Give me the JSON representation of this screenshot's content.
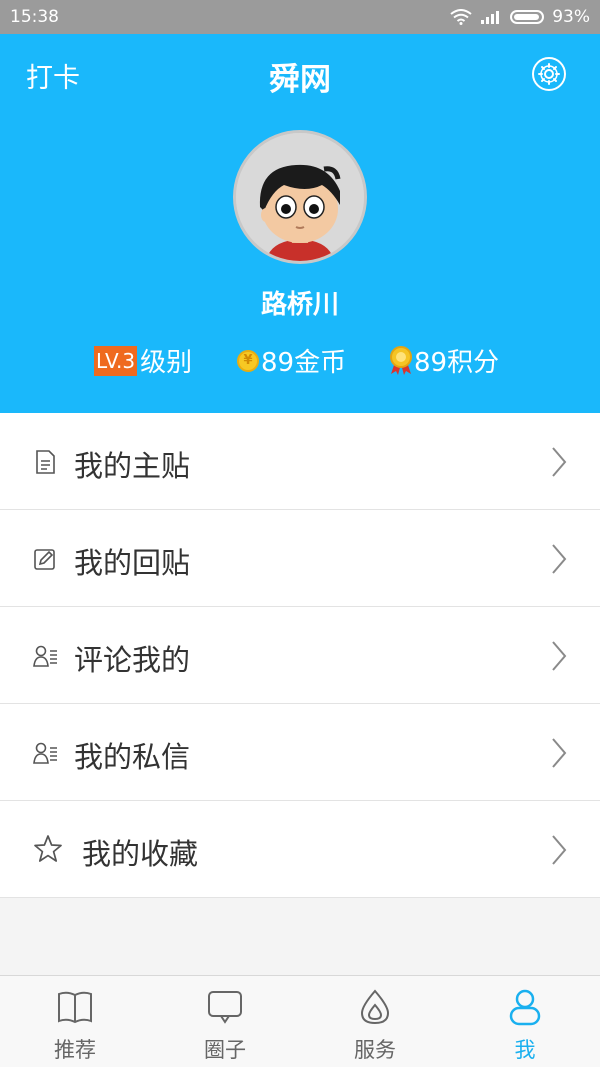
{
  "status_bar": {
    "time": "15:38",
    "battery": "93%"
  },
  "header": {
    "checkin_label": "打卡",
    "app_title": "舜网",
    "username": "路桥川",
    "stats": {
      "level_badge": "LV.3",
      "level_label": "级别",
      "coin_symbol": "¥",
      "coins_label": "89金币",
      "points_label": "89积分"
    }
  },
  "menu": {
    "items": [
      {
        "label": "我的主贴",
        "icon": "document-icon"
      },
      {
        "label": "我的回贴",
        "icon": "edit-icon"
      },
      {
        "label": "评论我的",
        "icon": "user-list-icon"
      },
      {
        "label": "我的私信",
        "icon": "user-list-icon"
      },
      {
        "label": "我的收藏",
        "icon": "star-icon"
      }
    ]
  },
  "tabbar": {
    "tabs": [
      {
        "label": "推荐",
        "icon": "book-icon",
        "active": false
      },
      {
        "label": "圈子",
        "icon": "chat-icon",
        "active": false
      },
      {
        "label": "服务",
        "icon": "drop-icon",
        "active": false
      },
      {
        "label": "我",
        "icon": "person-icon",
        "active": true
      }
    ]
  },
  "colors": {
    "primary": "#1ab8fb",
    "level_badge": "#ef6a1f",
    "active_tab": "#1ab0ef"
  }
}
